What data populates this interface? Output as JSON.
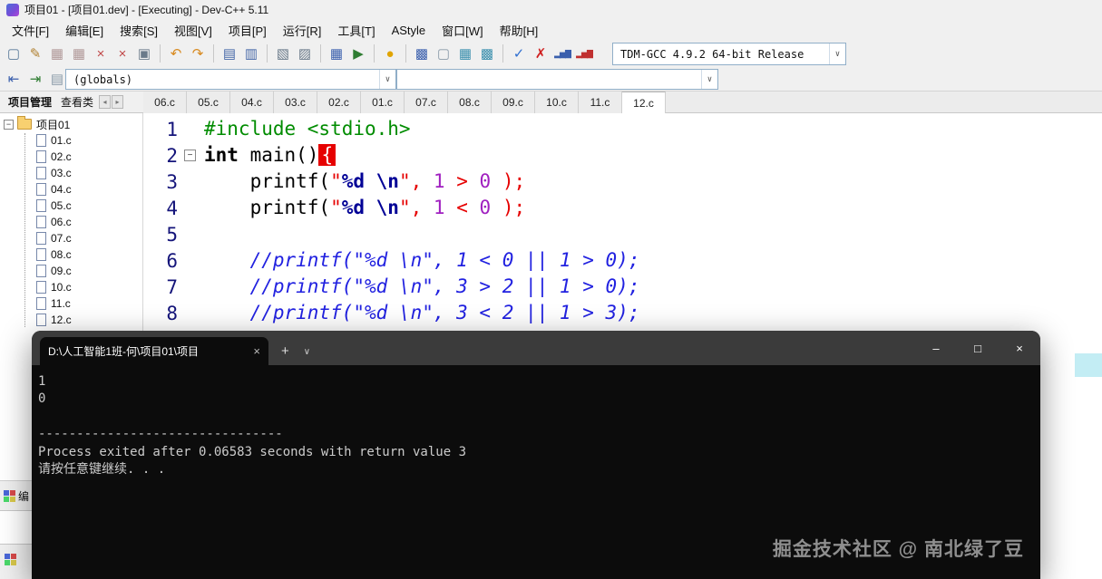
{
  "window": {
    "title": "项目01 - [项目01.dev] - [Executing] - Dev-C++ 5.11"
  },
  "menu": {
    "items": [
      "文件[F]",
      "编辑[E]",
      "搜索[S]",
      "视图[V]",
      "项目[P]",
      "运行[R]",
      "工具[T]",
      "AStyle",
      "窗口[W]",
      "帮助[H]"
    ]
  },
  "toolbars": {
    "compiler_select": "TDM-GCC 4.9.2 64-bit Release",
    "globals_select": "(globals)",
    "members_select": "",
    "dropdown_arrow": "∨",
    "row1": [
      {
        "name": "new-file-icon",
        "glyph": "▢",
        "fg": "#5a7a9a"
      },
      {
        "name": "open-file-icon",
        "glyph": "✎",
        "fg": "#b08030"
      },
      {
        "name": "save-icon",
        "glyph": "▦",
        "fg": "#b09898"
      },
      {
        "name": "save-all-icon",
        "glyph": "▦",
        "fg": "#b09898"
      },
      {
        "name": "close-file-icon",
        "glyph": "×",
        "fg": "#c04848"
      },
      {
        "name": "close-all-icon",
        "glyph": "×",
        "fg": "#c04848"
      },
      {
        "name": "print-icon",
        "glyph": "▣",
        "fg": "#6a7a8a"
      },
      {
        "sep": true
      },
      {
        "name": "undo-icon",
        "glyph": "↶",
        "fg": "#d88a20"
      },
      {
        "name": "redo-icon",
        "glyph": "↷",
        "fg": "#d88a20"
      },
      {
        "sep": true
      },
      {
        "name": "find-icon",
        "glyph": "▤",
        "fg": "#4668a8"
      },
      {
        "name": "replace-icon",
        "glyph": "▥",
        "fg": "#4668a8"
      },
      {
        "sep": true
      },
      {
        "name": "goto-function-icon",
        "glyph": "▧",
        "fg": "#6a7a8a"
      },
      {
        "name": "goto-line-icon",
        "glyph": "▨",
        "fg": "#6a7a8a"
      },
      {
        "sep": true
      },
      {
        "name": "compile-icon",
        "glyph": "▦",
        "fg": "#3a5fad"
      },
      {
        "name": "run-icon",
        "glyph": "▶",
        "fg": "#2f7d32"
      },
      {
        "sep": true
      },
      {
        "name": "compile-run-icon",
        "glyph": "●",
        "fg": "#e0a400"
      },
      {
        "sep": true
      },
      {
        "name": "rebuild-icon",
        "glyph": "▩",
        "fg": "#3a5fad"
      },
      {
        "name": "clean-icon",
        "glyph": "▢",
        "fg": "#8a9aa8"
      },
      {
        "name": "window-layout-icon",
        "glyph": "▦",
        "fg": "#3a8fad"
      },
      {
        "name": "window-grid-icon",
        "glyph": "▩",
        "fg": "#3a8fad"
      },
      {
        "sep": true
      },
      {
        "name": "syntax-check-icon",
        "glyph": "✓",
        "fg": "#2f6fd0"
      },
      {
        "name": "abort-icon",
        "glyph": "✗",
        "fg": "#d02020"
      },
      {
        "name": "profile-icon",
        "glyph": "▂▅▇",
        "fg": "#3a5fad",
        "small": true
      },
      {
        "name": "profile-clean-icon",
        "glyph": "▂▅▇",
        "fg": "#c03030",
        "small": true
      }
    ],
    "row2": [
      {
        "name": "jump-back-icon",
        "glyph": "⇤",
        "fg": "#3a5fad"
      },
      {
        "name": "jump-forward-icon",
        "glyph": "⇥",
        "fg": "#2f7d32"
      },
      {
        "name": "header-source-icon",
        "glyph": "▤",
        "fg": "#8a9aa8"
      }
    ]
  },
  "sidebar": {
    "tabs": [
      {
        "label": "项目管理"
      },
      {
        "label": "查看类"
      }
    ],
    "nav": [
      "◂",
      "▸"
    ],
    "tree": {
      "root": "项目01",
      "expander": "−",
      "files": [
        "01.c",
        "02.c",
        "03.c",
        "04.c",
        "05.c",
        "06.c",
        "07.c",
        "08.c",
        "09.c",
        "10.c",
        "11.c",
        "12.c"
      ]
    }
  },
  "editor": {
    "tabs": [
      "06.c",
      "05.c",
      "04.c",
      "03.c",
      "02.c",
      "01.c",
      "07.c",
      "08.c",
      "09.c",
      "10.c",
      "11.c",
      "12.c"
    ],
    "active_tab": "12.c",
    "fold_glyph": "−",
    "lines": [
      {
        "num": 1,
        "segments": [
          {
            "c": "preproc",
            "t": "#include <stdio.h>"
          }
        ]
      },
      {
        "num": 2,
        "fold": true,
        "segments": [
          {
            "c": "kw",
            "t": "int"
          },
          {
            "c": "plain",
            "t": " main()"
          },
          {
            "c": "brace",
            "t": "{"
          }
        ]
      },
      {
        "num": 3,
        "segments": [
          {
            "c": "plain",
            "t": "    printf("
          },
          {
            "c": "str",
            "t": "\""
          },
          {
            "c": "fmt",
            "t": "%d \\n"
          },
          {
            "c": "str",
            "t": "\""
          },
          {
            "c": "op",
            "t": ","
          },
          {
            "c": "plain",
            "t": " "
          },
          {
            "c": "num",
            "t": "1"
          },
          {
            "c": "plain",
            "t": " "
          },
          {
            "c": "op",
            "t": ">"
          },
          {
            "c": "plain",
            "t": " "
          },
          {
            "c": "num",
            "t": "0"
          },
          {
            "c": "plain",
            "t": " "
          },
          {
            "c": "op",
            "t": ");"
          }
        ]
      },
      {
        "num": 4,
        "segments": [
          {
            "c": "plain",
            "t": "    printf("
          },
          {
            "c": "str",
            "t": "\""
          },
          {
            "c": "fmt",
            "t": "%d \\n"
          },
          {
            "c": "str",
            "t": "\""
          },
          {
            "c": "op",
            "t": ","
          },
          {
            "c": "plain",
            "t": " "
          },
          {
            "c": "num",
            "t": "1"
          },
          {
            "c": "plain",
            "t": " "
          },
          {
            "c": "op",
            "t": "<"
          },
          {
            "c": "plain",
            "t": " "
          },
          {
            "c": "num",
            "t": "0"
          },
          {
            "c": "plain",
            "t": " "
          },
          {
            "c": "op",
            "t": ");"
          }
        ]
      },
      {
        "num": 5,
        "segments": []
      },
      {
        "num": 6,
        "segments": [
          {
            "c": "comment",
            "t": "    //printf(\"%d \\n\", 1 < 0 || 1 > 0);"
          }
        ]
      },
      {
        "num": 7,
        "segments": [
          {
            "c": "comment",
            "t": "    //printf(\"%d \\n\", 3 > 2 || 1 > 0);"
          }
        ]
      },
      {
        "num": 8,
        "segments": [
          {
            "c": "comment",
            "t": "    //printf(\"%d \\n\", 3 < 2 || 1 > 3);"
          }
        ]
      }
    ]
  },
  "console": {
    "tab_title": "D:\\人工智能1班-何\\项目01\\项目",
    "tab_close": "×",
    "new_tab": "+",
    "dropdown": "∨",
    "controls": {
      "minimize": "–",
      "maximize": "□",
      "close": "×"
    },
    "lines": [
      "1",
      "0",
      "",
      "--------------------------------",
      "Process exited after 0.06583 seconds with return value 3",
      "请按任意键继续. . ."
    ]
  },
  "bottom_panel": {
    "compile_label": "编"
  },
  "watermark": "掘金技术社区 @ 南北绿了豆",
  "colors": {
    "preprocessor_green": "#008c00",
    "string_red": "#e60000",
    "format_navy": "#000096",
    "number_purple": "#a020c0",
    "comment_blue": "#2121e0",
    "brace_highlight_bg": "#e60000",
    "console_bg": "#0c0c0c",
    "console_text": "#cccccc",
    "console_tabbar": "#3b3b3b",
    "chrome_gray": "#f0f0f0"
  }
}
